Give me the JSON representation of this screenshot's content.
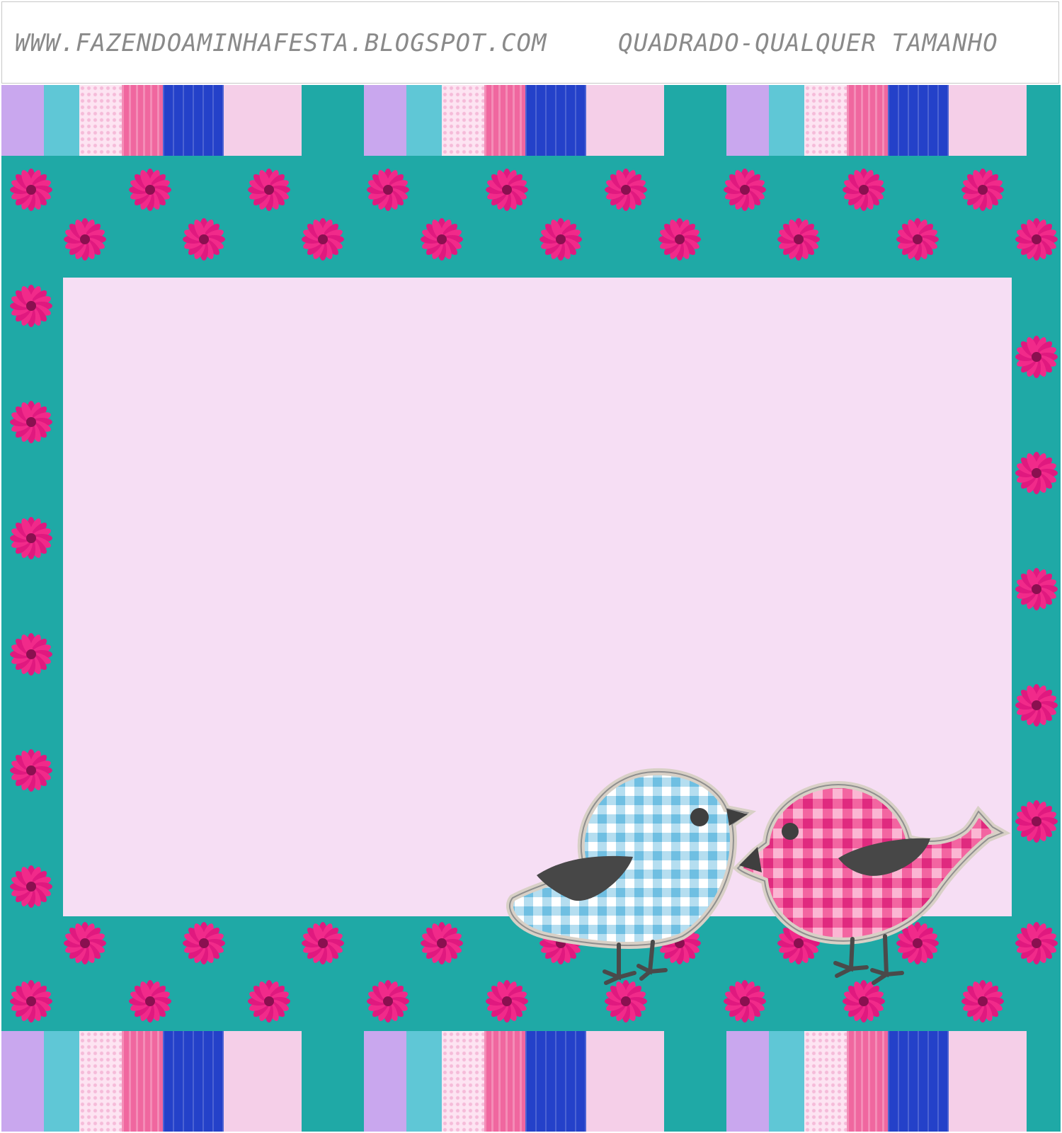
{
  "header": {
    "left_text": "WWW.FAZENDOAMINHAFESTA.BLOGSPOT.COM",
    "right_text": "QUADRADO-QUALQUER TAMANHO"
  },
  "colors": {
    "teal": "#1fa9a6",
    "inner_panel": "#f6def4",
    "flower": "#e0197f",
    "blue_bird": "#9fd6ec",
    "pink_bird": "#f24f97",
    "wing": "#4a4a4a"
  },
  "icons": [
    "flower-icon",
    "blue-bird-icon",
    "pink-bird-icon"
  ]
}
